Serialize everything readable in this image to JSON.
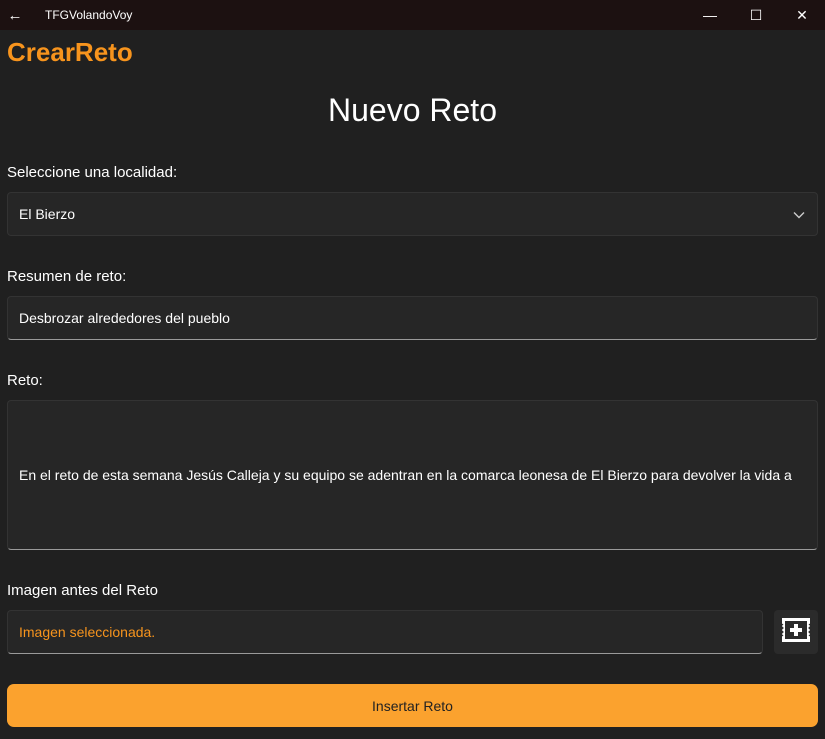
{
  "window": {
    "title": "TFGVolandoVoy",
    "back_glyph": "←",
    "minimize_glyph": "—",
    "maximize_glyph": "☐",
    "close_glyph": "✕"
  },
  "page": {
    "brand": "CrearReto",
    "heading": "Nuevo Reto"
  },
  "form": {
    "locality_label": "Seleccione una localidad:",
    "locality_value": "El Bierzo",
    "summary_label": "Resumen de reto:",
    "summary_value": "Desbrozar alrededores del pueblo",
    "challenge_label": "Reto:",
    "challenge_value": "En el reto de esta semana Jesús Calleja y su equipo se adentran en la comarca leonesa de El Bierzo para devolver la vida a",
    "image_label": "Imagen antes del Reto",
    "image_value": "Imagen seleccionada.",
    "submit_label": "Insertar Reto"
  },
  "icons": {
    "back": "back-arrow-icon",
    "dropdown": "chevron-down-icon",
    "add_image": "add-image-icon"
  },
  "colors": {
    "accent": "#f7941d",
    "button": "#fba22e",
    "background": "#202020"
  }
}
